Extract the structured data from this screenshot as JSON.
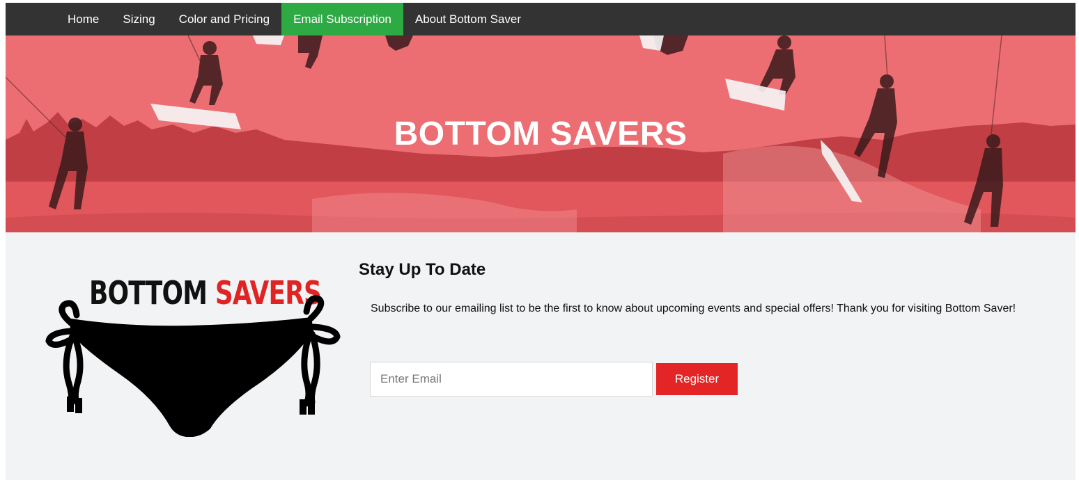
{
  "nav": {
    "items": [
      {
        "label": "Home"
      },
      {
        "label": "Sizing"
      },
      {
        "label": "Color and Pricing"
      },
      {
        "label": "Email Subscription",
        "active": true
      },
      {
        "label": "About Bottom Saver"
      }
    ],
    "active_color": "#2eaa45",
    "background": "#333333"
  },
  "hero": {
    "title": "BOTTOM SAVERS",
    "tint_color": "#e8686c"
  },
  "logo": {
    "word1": "BOTTOM",
    "word2": "SAVERS",
    "icon": "bikini-bottom-icon",
    "accent_color": "#e02424"
  },
  "subscribe": {
    "title": "Stay Up To Date",
    "text": "Subscribe to our emailing list to be the first to know about upcoming events and special offers! Thank you for visiting Bottom Saver!",
    "email_placeholder": "Enter Email",
    "email_value": "",
    "register_label": "Register",
    "button_color": "#e42525"
  }
}
